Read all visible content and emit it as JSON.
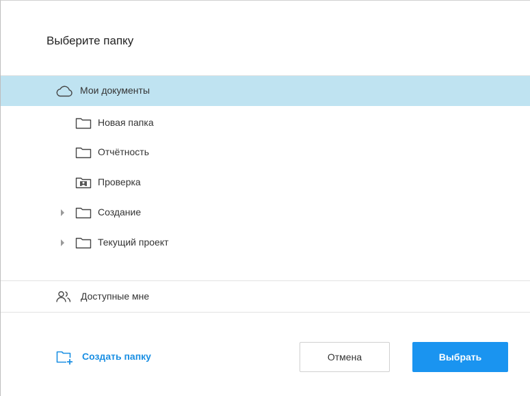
{
  "dialog": {
    "title": "Выберите папку"
  },
  "tree": {
    "root": {
      "label": "Мои документы",
      "icon": "cloud-icon",
      "selected": true
    },
    "items": [
      {
        "label": "Новая папка",
        "icon": "folder-icon",
        "expandable": false
      },
      {
        "label": "Отчётность",
        "icon": "folder-icon",
        "expandable": false
      },
      {
        "label": "Проверка",
        "icon": "shared-folder-icon",
        "expandable": false
      },
      {
        "label": "Создание",
        "icon": "folder-icon",
        "expandable": true
      },
      {
        "label": "Текущий проект",
        "icon": "folder-icon",
        "expandable": true
      }
    ]
  },
  "shared": {
    "label": "Доступные мне",
    "icon": "users-icon"
  },
  "footer": {
    "create_folder_label": "Создать папку",
    "cancel_label": "Отмена",
    "select_label": "Выбрать"
  },
  "colors": {
    "selection": "#bfe3f1",
    "accent": "#1a94f0",
    "link": "#1a8fe3"
  }
}
